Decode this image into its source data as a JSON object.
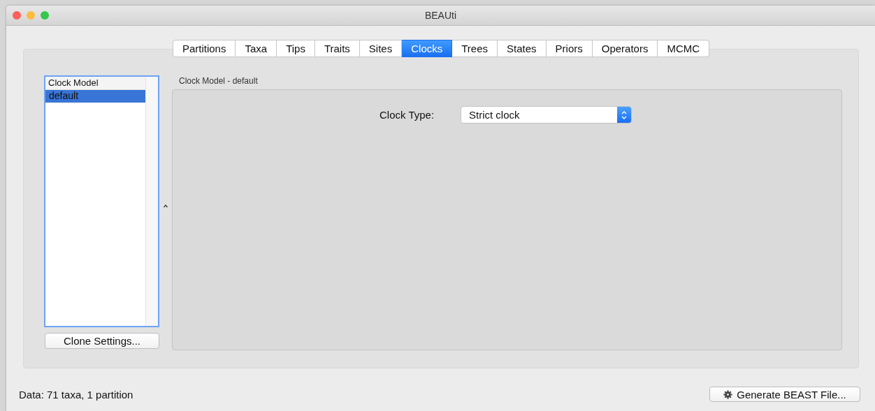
{
  "window": {
    "title": "BEAUti"
  },
  "tabs": [
    {
      "label": "Partitions",
      "selected": false
    },
    {
      "label": "Taxa",
      "selected": false
    },
    {
      "label": "Tips",
      "selected": false
    },
    {
      "label": "Traits",
      "selected": false
    },
    {
      "label": "Sites",
      "selected": false
    },
    {
      "label": "Clocks",
      "selected": true
    },
    {
      "label": "Trees",
      "selected": false
    },
    {
      "label": "States",
      "selected": false
    },
    {
      "label": "Priors",
      "selected": false
    },
    {
      "label": "Operators",
      "selected": false
    },
    {
      "label": "MCMC",
      "selected": false
    }
  ],
  "clock_list": {
    "header": "Clock Model",
    "items": [
      {
        "label": "default",
        "selected": true
      }
    ]
  },
  "clone_button": "Clone Settings...",
  "detail": {
    "title": "Clock Model - default",
    "field_label": "Clock Type:",
    "field_value": "Strict clock"
  },
  "status_bar": {
    "text": "Data: 71 taxa, 1 partition",
    "button": "Generate BEAST File..."
  }
}
